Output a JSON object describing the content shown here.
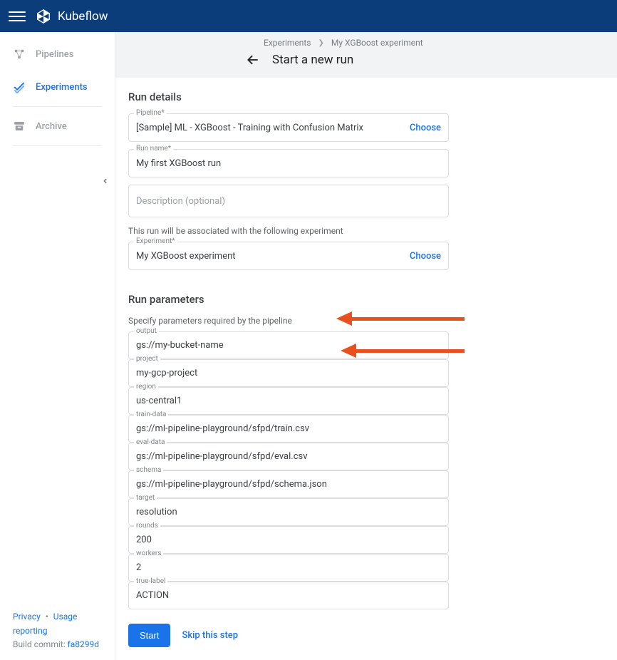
{
  "topbar": {
    "app_name": "Kubeflow"
  },
  "sidebar": {
    "items": [
      {
        "label": "Pipelines"
      },
      {
        "label": "Experiments"
      },
      {
        "label": "Archive"
      }
    ],
    "footer": {
      "privacy": "Privacy",
      "usage": "Usage reporting",
      "build_prefix": "Build commit:",
      "build_hash": "fa8299d"
    }
  },
  "breadcrumb": {
    "items": [
      "Experiments",
      "My XGBoost experiment"
    ]
  },
  "page": {
    "title": "Start a new run"
  },
  "run_details": {
    "heading": "Run details",
    "pipeline_label": "Pipeline*",
    "pipeline_value": "[Sample] ML - XGBoost - Training with Confusion Matrix",
    "choose_label": "Choose",
    "run_name_label": "Run name*",
    "run_name_value": "My first XGBoost run",
    "description_placeholder": "Description (optional)",
    "assoc_text": "This run will be associated with the following experiment",
    "experiment_label": "Experiment*",
    "experiment_value": "My XGBoost experiment"
  },
  "run_params": {
    "heading": "Run parameters",
    "sub": "Specify parameters required by the pipeline",
    "fields": [
      {
        "label": "output",
        "value": "gs://my-bucket-name"
      },
      {
        "label": "project",
        "value": "my-gcp-project"
      },
      {
        "label": "region",
        "value": "us-central1"
      },
      {
        "label": "train-data",
        "value": "gs://ml-pipeline-playground/sfpd/train.csv"
      },
      {
        "label": "eval-data",
        "value": "gs://ml-pipeline-playground/sfpd/eval.csv"
      },
      {
        "label": "schema",
        "value": "gs://ml-pipeline-playground/sfpd/schema.json"
      },
      {
        "label": "target",
        "value": "resolution"
      },
      {
        "label": "rounds",
        "value": "200"
      },
      {
        "label": "workers",
        "value": "2"
      },
      {
        "label": "true-label",
        "value": "ACTION"
      }
    ]
  },
  "buttons": {
    "start": "Start",
    "skip": "Skip this step"
  }
}
